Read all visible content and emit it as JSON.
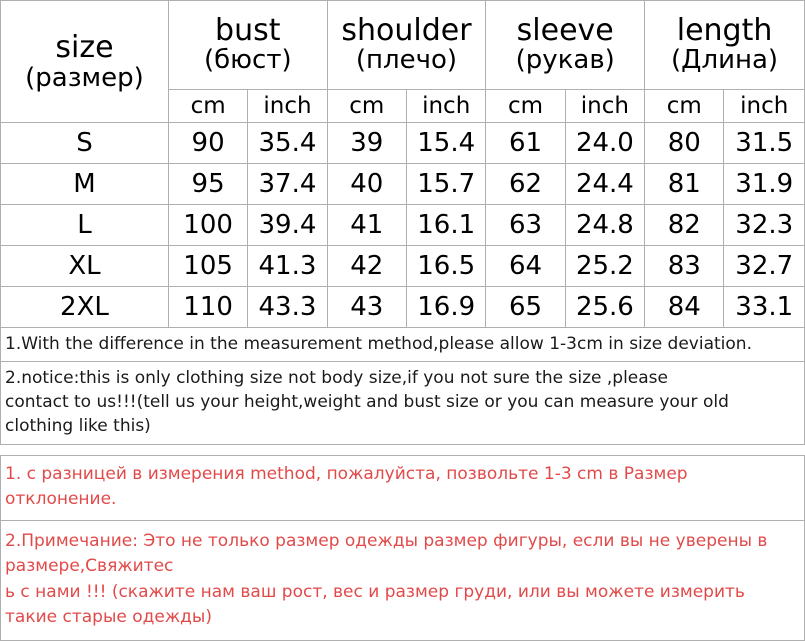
{
  "table": {
    "size_header": {
      "en": "size",
      "ru": "(размер)"
    },
    "measurement_headers": [
      {
        "en": "bust",
        "ru": "(бюст)"
      },
      {
        "en": "shoulder",
        "ru": "(плечо)"
      },
      {
        "en": "sleeve",
        "ru": "(рукав)"
      },
      {
        "en": "length",
        "ru": "(Длина)"
      }
    ],
    "unit_headers": [
      "cm",
      "inch",
      "cm",
      "inch",
      "cm",
      "inch",
      "cm",
      "inch"
    ],
    "rows": [
      {
        "size": "S",
        "bust_cm": "90",
        "bust_inch": "35.4",
        "shoulder_cm": "39",
        "shoulder_inch": "15.4",
        "sleeve_cm": "61",
        "sleeve_inch": "24.0",
        "length_cm": "80",
        "length_inch": "31.5"
      },
      {
        "size": "M",
        "bust_cm": "95",
        "bust_inch": "37.4",
        "shoulder_cm": "40",
        "shoulder_inch": "15.7",
        "sleeve_cm": "62",
        "sleeve_inch": "24.4",
        "length_cm": "81",
        "length_inch": "31.9"
      },
      {
        "size": "L",
        "bust_cm": "100",
        "bust_inch": "39.4",
        "shoulder_cm": "41",
        "shoulder_inch": "16.1",
        "sleeve_cm": "63",
        "sleeve_inch": "24.8",
        "length_cm": "82",
        "length_inch": "32.3"
      },
      {
        "size": "XL",
        "bust_cm": "105",
        "bust_inch": "41.3",
        "shoulder_cm": "42",
        "shoulder_inch": "16.5",
        "sleeve_cm": "64",
        "sleeve_inch": "25.2",
        "length_cm": "83",
        "length_inch": "32.7"
      },
      {
        "size": "2XL",
        "bust_cm": "110",
        "bust_inch": "43.3",
        "shoulder_cm": "43",
        "shoulder_inch": "16.9",
        "sleeve_cm": "65",
        "sleeve_inch": "25.6",
        "length_cm": "84",
        "length_inch": "33.1"
      }
    ]
  },
  "notes_en": [
    "1.With the difference in the measurement method,please allow 1-3cm in size deviation.",
    "2.notice:this is only clothing size not body size,if you not sure the size ,please\ncontact to us!!!(tell us your height,weight and bust size or you can measure your old clothing like this)"
  ],
  "notes_ru": [
    "1. с разницей в измерения method, пожалуйста, позвольте 1-3 cm в Размер отклонение.",
    "2.Примечание: Это не только размер одежды размер фигуры, если вы не уверены в размере,Свяжитес\nь с нами !!! (скажите нам ваш рост, вес и размер груди, или вы можете измерить такие старые одежды)"
  ],
  "colors": {
    "note_red": "#e24a4a",
    "border": "#b0b0b0",
    "text": "#000000",
    "background": "#ffffff"
  }
}
